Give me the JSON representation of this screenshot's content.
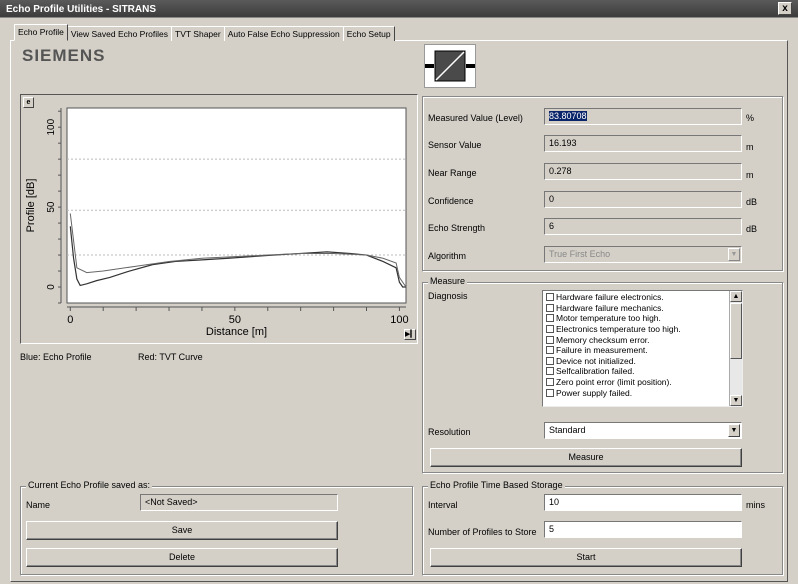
{
  "window": {
    "title": "Echo Profile Utilities - SITRANS",
    "close_label": "x"
  },
  "tabs": [
    "Echo Profile",
    "View Saved Echo Profiles",
    "TVT Shaper",
    "Auto False Echo Suppression",
    "Echo Setup"
  ],
  "brand": "SIEMENS",
  "plot": {
    "corner_glyph": "e",
    "legend_echo": "Blue: Echo Profile",
    "legend_tvt": "Red: TVT Curve"
  },
  "chart_data": {
    "type": "line",
    "xlabel": "Distance [m]",
    "ylabel": "Profile [dB]",
    "x_ticks": [
      "0",
      "50",
      "100"
    ],
    "y_ticks": [
      "0",
      "50",
      "100"
    ],
    "xlim": [
      -1,
      102
    ],
    "ylim": [
      -10,
      112
    ],
    "hlines": [
      20,
      48,
      80
    ],
    "series": [
      {
        "name": "Echo Profile",
        "x": [
          0,
          1,
          2,
          3,
          5,
          8,
          12,
          18,
          25,
          32,
          40,
          48,
          55,
          62,
          70,
          78,
          85,
          90,
          95,
          99,
          100,
          101,
          102
        ],
        "y": [
          38,
          18,
          5,
          1,
          2,
          4,
          6,
          10,
          14,
          16,
          17,
          18,
          19,
          20,
          21,
          22,
          21,
          20,
          16,
          12,
          3,
          0,
          0
        ]
      },
      {
        "name": "TVT Curve",
        "x": [
          0,
          2,
          5,
          10,
          20,
          30,
          40,
          50,
          60,
          70,
          80,
          90,
          95,
          99,
          100,
          102
        ],
        "y": [
          46,
          12,
          9,
          10,
          13,
          16,
          18,
          19,
          20,
          21,
          21,
          20,
          18,
          15,
          6,
          0
        ]
      }
    ]
  },
  "readings": {
    "measured_label": "Measured Value (Level)",
    "measured_value": "83.80708",
    "measured_unit": "%",
    "sensor_label": "Sensor Value",
    "sensor_value": "16.193",
    "sensor_unit": "m",
    "near_label": "Near Range",
    "near_value": "0.278",
    "near_unit": "m",
    "confidence_label": "Confidence",
    "confidence_value": "0",
    "confidence_unit": "dB",
    "strength_label": "Echo Strength",
    "strength_value": "6",
    "strength_unit": "dB",
    "algorithm_label": "Algorithm",
    "algorithm_value": "True First Echo"
  },
  "measure": {
    "group_label": "Measure",
    "diagnosis_label": "Diagnosis",
    "diagnosis_items": [
      "Hardware failure electronics.",
      "Hardware failure mechanics.",
      "Motor temperature too high.",
      "Electronics temperature too high.",
      "Memory checksum error.",
      "Failure in measurement.",
      "Device not initialized.",
      "Selfcalibration failed.",
      "Zero point error (limit position).",
      "Power supply failed."
    ],
    "resolution_label": "Resolution",
    "resolution_value": "Standard",
    "measure_button": "Measure"
  },
  "saved": {
    "group_label": "Current Echo Profile saved as:",
    "name_label": "Name",
    "name_value": "<Not Saved>",
    "save_button": "Save",
    "delete_button": "Delete"
  },
  "storage": {
    "group_label": "Echo Profile Time Based Storage",
    "interval_label": "Interval",
    "interval_value": "10",
    "interval_unit": "mins",
    "count_label": "Number of Profiles to Store",
    "count_value": "5",
    "start_button": "Start"
  },
  "colors": {
    "echo": "#333333",
    "tvt": "#666666",
    "grid": "#bbbbbb"
  }
}
